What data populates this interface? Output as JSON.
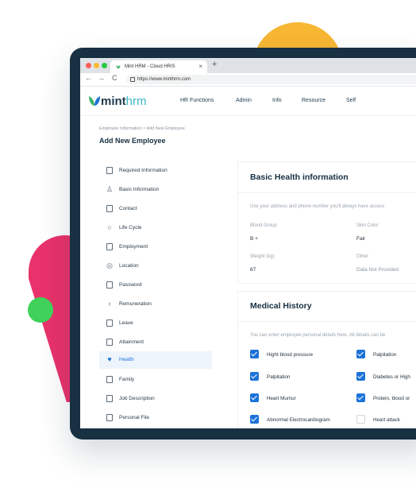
{
  "colors": {
    "accent": "#1d72d8",
    "frame": "#173042",
    "deco_yellow": "#f7b733",
    "deco_pink": "#e9326b",
    "deco_green": "#3fd159"
  },
  "browser": {
    "tab_title": "Mint HRM - Cloud HRIS",
    "tab_close": "×",
    "new_tab": "+",
    "nav": {
      "back": "←",
      "forward": "→",
      "reload": "C"
    },
    "url": "https://www.minthrm.com"
  },
  "app": {
    "logo_main": "mint",
    "logo_accent": "hrm",
    "menu": [
      "HR Functions",
      "Admin",
      "Info",
      "Resource",
      "Self"
    ]
  },
  "page": {
    "breadcrumb": "Employee Information > Add New Employee",
    "title": "Add New Employee"
  },
  "sidebar": {
    "items": [
      {
        "label": "Required Information",
        "icon": "id-card-icon"
      },
      {
        "label": "Basic Information",
        "icon": "user-icon"
      },
      {
        "label": "Contact",
        "icon": "address-book-icon"
      },
      {
        "label": "Life Cycle",
        "icon": "cycle-icon"
      },
      {
        "label": "Employment",
        "icon": "briefcase-icon"
      },
      {
        "label": "Location",
        "icon": "location-pin-icon"
      },
      {
        "label": "Password",
        "icon": "lock-icon"
      },
      {
        "label": "Remuneration",
        "icon": "money-bag-icon"
      },
      {
        "label": "Leave",
        "icon": "calendar-minus-icon"
      },
      {
        "label": "Attainment",
        "icon": "certificate-icon"
      },
      {
        "label": "Health",
        "icon": "heart-icon",
        "active": true
      },
      {
        "label": "Family",
        "icon": "family-icon"
      },
      {
        "label": "Job Description",
        "icon": "document-icon"
      },
      {
        "label": "Personal File",
        "icon": "file-icon"
      }
    ]
  },
  "health": {
    "title": "Basic Health information",
    "description": "Use your address and phone number you'll always have access",
    "fields": [
      {
        "label": "Blood Group",
        "value": "B +"
      },
      {
        "label": "Skin Color",
        "value": "Fair"
      },
      {
        "label": "Weight (kg)",
        "value": "67"
      },
      {
        "label": "Other",
        "value": "Data Not Provided"
      }
    ]
  },
  "medical": {
    "title": "Medical History",
    "description": "You can enter employee personal details here, All details can be",
    "items": [
      {
        "label": "Hight blood pressure",
        "checked": true
      },
      {
        "label": "Palpitation",
        "checked": true
      },
      {
        "label": "Palpitation",
        "checked": true
      },
      {
        "label": "Diabetes or High",
        "checked": true
      },
      {
        "label": "Heart Mumur",
        "checked": true
      },
      {
        "label": "Protein, blood or",
        "checked": true
      },
      {
        "label": "Abnormal Electrocardiogram",
        "checked": true
      },
      {
        "label": "Heart attack",
        "checked": false
      }
    ]
  }
}
